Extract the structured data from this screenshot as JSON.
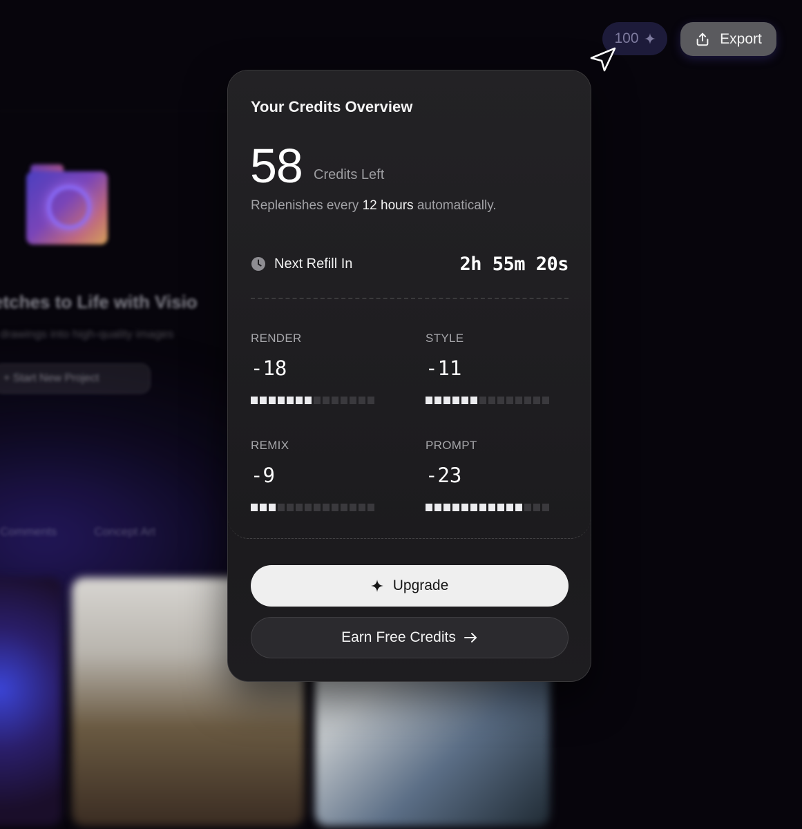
{
  "background": {
    "headline": "etches to Life with Visio",
    "subheadline": "drawings into high-quality images",
    "start_button": "+ Start New Project",
    "tabs": [
      "Comments",
      "Concept Art"
    ]
  },
  "toolbar": {
    "credits_chip": "100",
    "export_label": "Export"
  },
  "popover": {
    "title": "Your Credits Overview",
    "credits_left": "58",
    "credits_left_label": "Credits Left",
    "replenish_prefix": "Replenishes every ",
    "replenish_bold": "12 hours",
    "replenish_suffix": " automatically.",
    "next_refill_label": "Next Refill In",
    "next_refill_time": "2h 55m 20s",
    "stats": [
      {
        "label": "RENDER",
        "value": "-18",
        "filled": 7,
        "total": 14
      },
      {
        "label": "STYLE",
        "value": "-11",
        "filled": 6,
        "total": 14
      },
      {
        "label": "REMIX",
        "value": "-9",
        "filled": 3,
        "total": 14
      },
      {
        "label": "PROMPT",
        "value": "-23",
        "filled": 11,
        "total": 14
      }
    ],
    "upgrade_label": "Upgrade",
    "earn_label": "Earn Free Credits"
  },
  "colors": {
    "background": "#07050c",
    "popover": "#1f1e20",
    "upgrade_button": "#efefef",
    "credits_chip": "#1d1b3a"
  },
  "icons": [
    "sparkle-icon",
    "upload-icon",
    "cursor-arrow-icon",
    "clock-icon",
    "arrow-right-icon",
    "folder-icon"
  ]
}
